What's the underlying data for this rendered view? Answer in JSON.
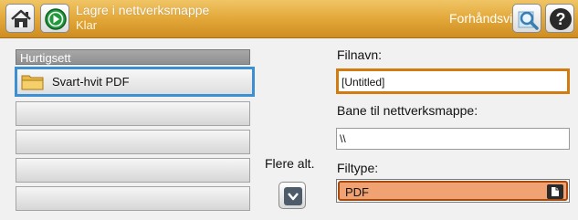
{
  "header": {
    "title": "Lagre i nettverksmappe",
    "status": "Klar",
    "preview_label": "Forhåndsvis",
    "icons": {
      "home": "home-icon",
      "start": "start-icon",
      "preview": "magnifier-icon",
      "help": "help-icon"
    }
  },
  "quick_sets": {
    "header": "Hurtigsett",
    "items": [
      {
        "label": "Svart-hvit PDF",
        "icon": "folder-icon",
        "selected": true
      },
      {
        "label": ""
      },
      {
        "label": ""
      },
      {
        "label": ""
      },
      {
        "label": ""
      }
    ]
  },
  "more_options": {
    "label": "Flere alt.",
    "icon": "chevron-down-icon"
  },
  "form": {
    "filename_label": "Filnavn:",
    "filename_value": "[Untitled]",
    "path_label": "Bane til nettverksmappe:",
    "path_value": "\\\\",
    "filetype_label": "Filtype:",
    "filetype_value": "PDF"
  },
  "colors": {
    "header": "#e1a536",
    "selection": "#3c8fd0",
    "active_field": "#d27b10",
    "dropdown": "#f0a272"
  }
}
